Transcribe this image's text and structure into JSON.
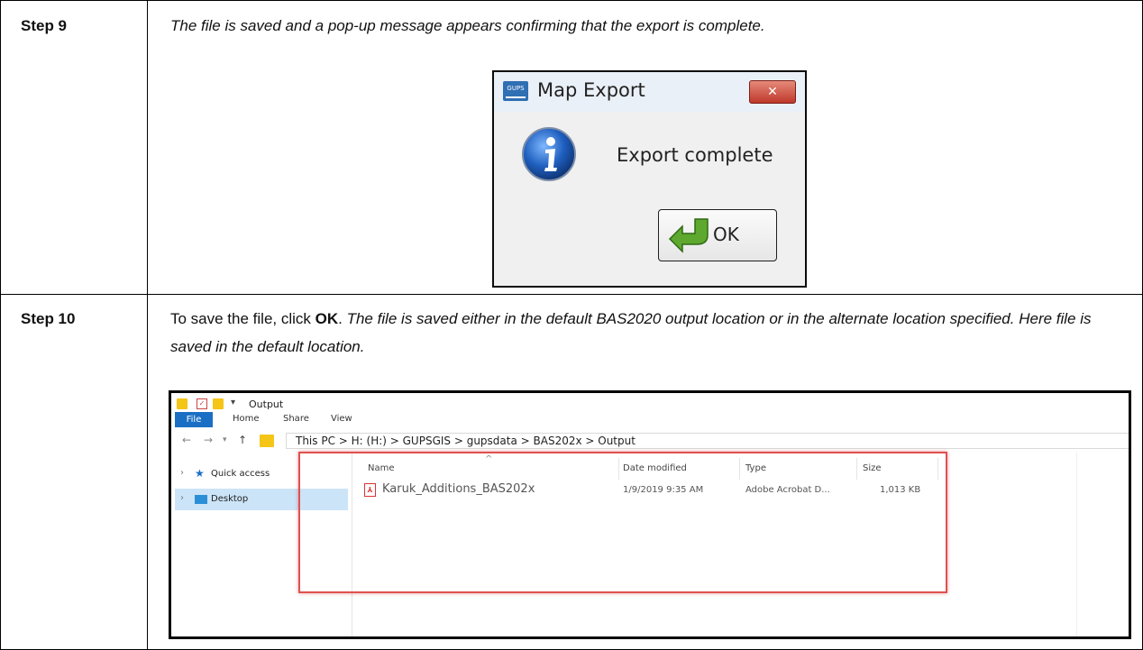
{
  "rows": [
    {
      "step": "Step 9",
      "desc_italic": "The file is saved and a pop-up message appears confirming that the export is complete."
    },
    {
      "step": "Step 10",
      "desc_prefix": "To save the file, click ",
      "desc_bold": "OK",
      "desc_period": ". ",
      "desc_italic": "The file is saved either in the default BAS2020 output location or in the alternate location specified. Here file is saved in the default location."
    }
  ],
  "dialog": {
    "app_icon_text": "GUPS",
    "title": "Map Export",
    "close_glyph": "✕",
    "message": "Export complete",
    "ok_label": "OK"
  },
  "explorer": {
    "window_title": "Output",
    "ribbon_tabs": [
      "File",
      "Home",
      "Share",
      "View"
    ],
    "address_path": "This PC > H: (H:) > GUPSGIS > gupsdata > BAS202x > Output",
    "nav_items": [
      "Quick access",
      "Desktop"
    ],
    "columns": [
      "Name",
      "Date modified",
      "Type",
      "Size"
    ],
    "files": [
      {
        "name": "Karuk_Additions_BAS202x",
        "date": "1/9/2019 9:35 AM",
        "type": "Adobe Acrobat D...",
        "size": "1,013 KB"
      }
    ]
  },
  "colors": {
    "highlight_box": "#e0514f",
    "file_tab": "#1a6fc4",
    "selected_nav": "#cce4f7"
  }
}
